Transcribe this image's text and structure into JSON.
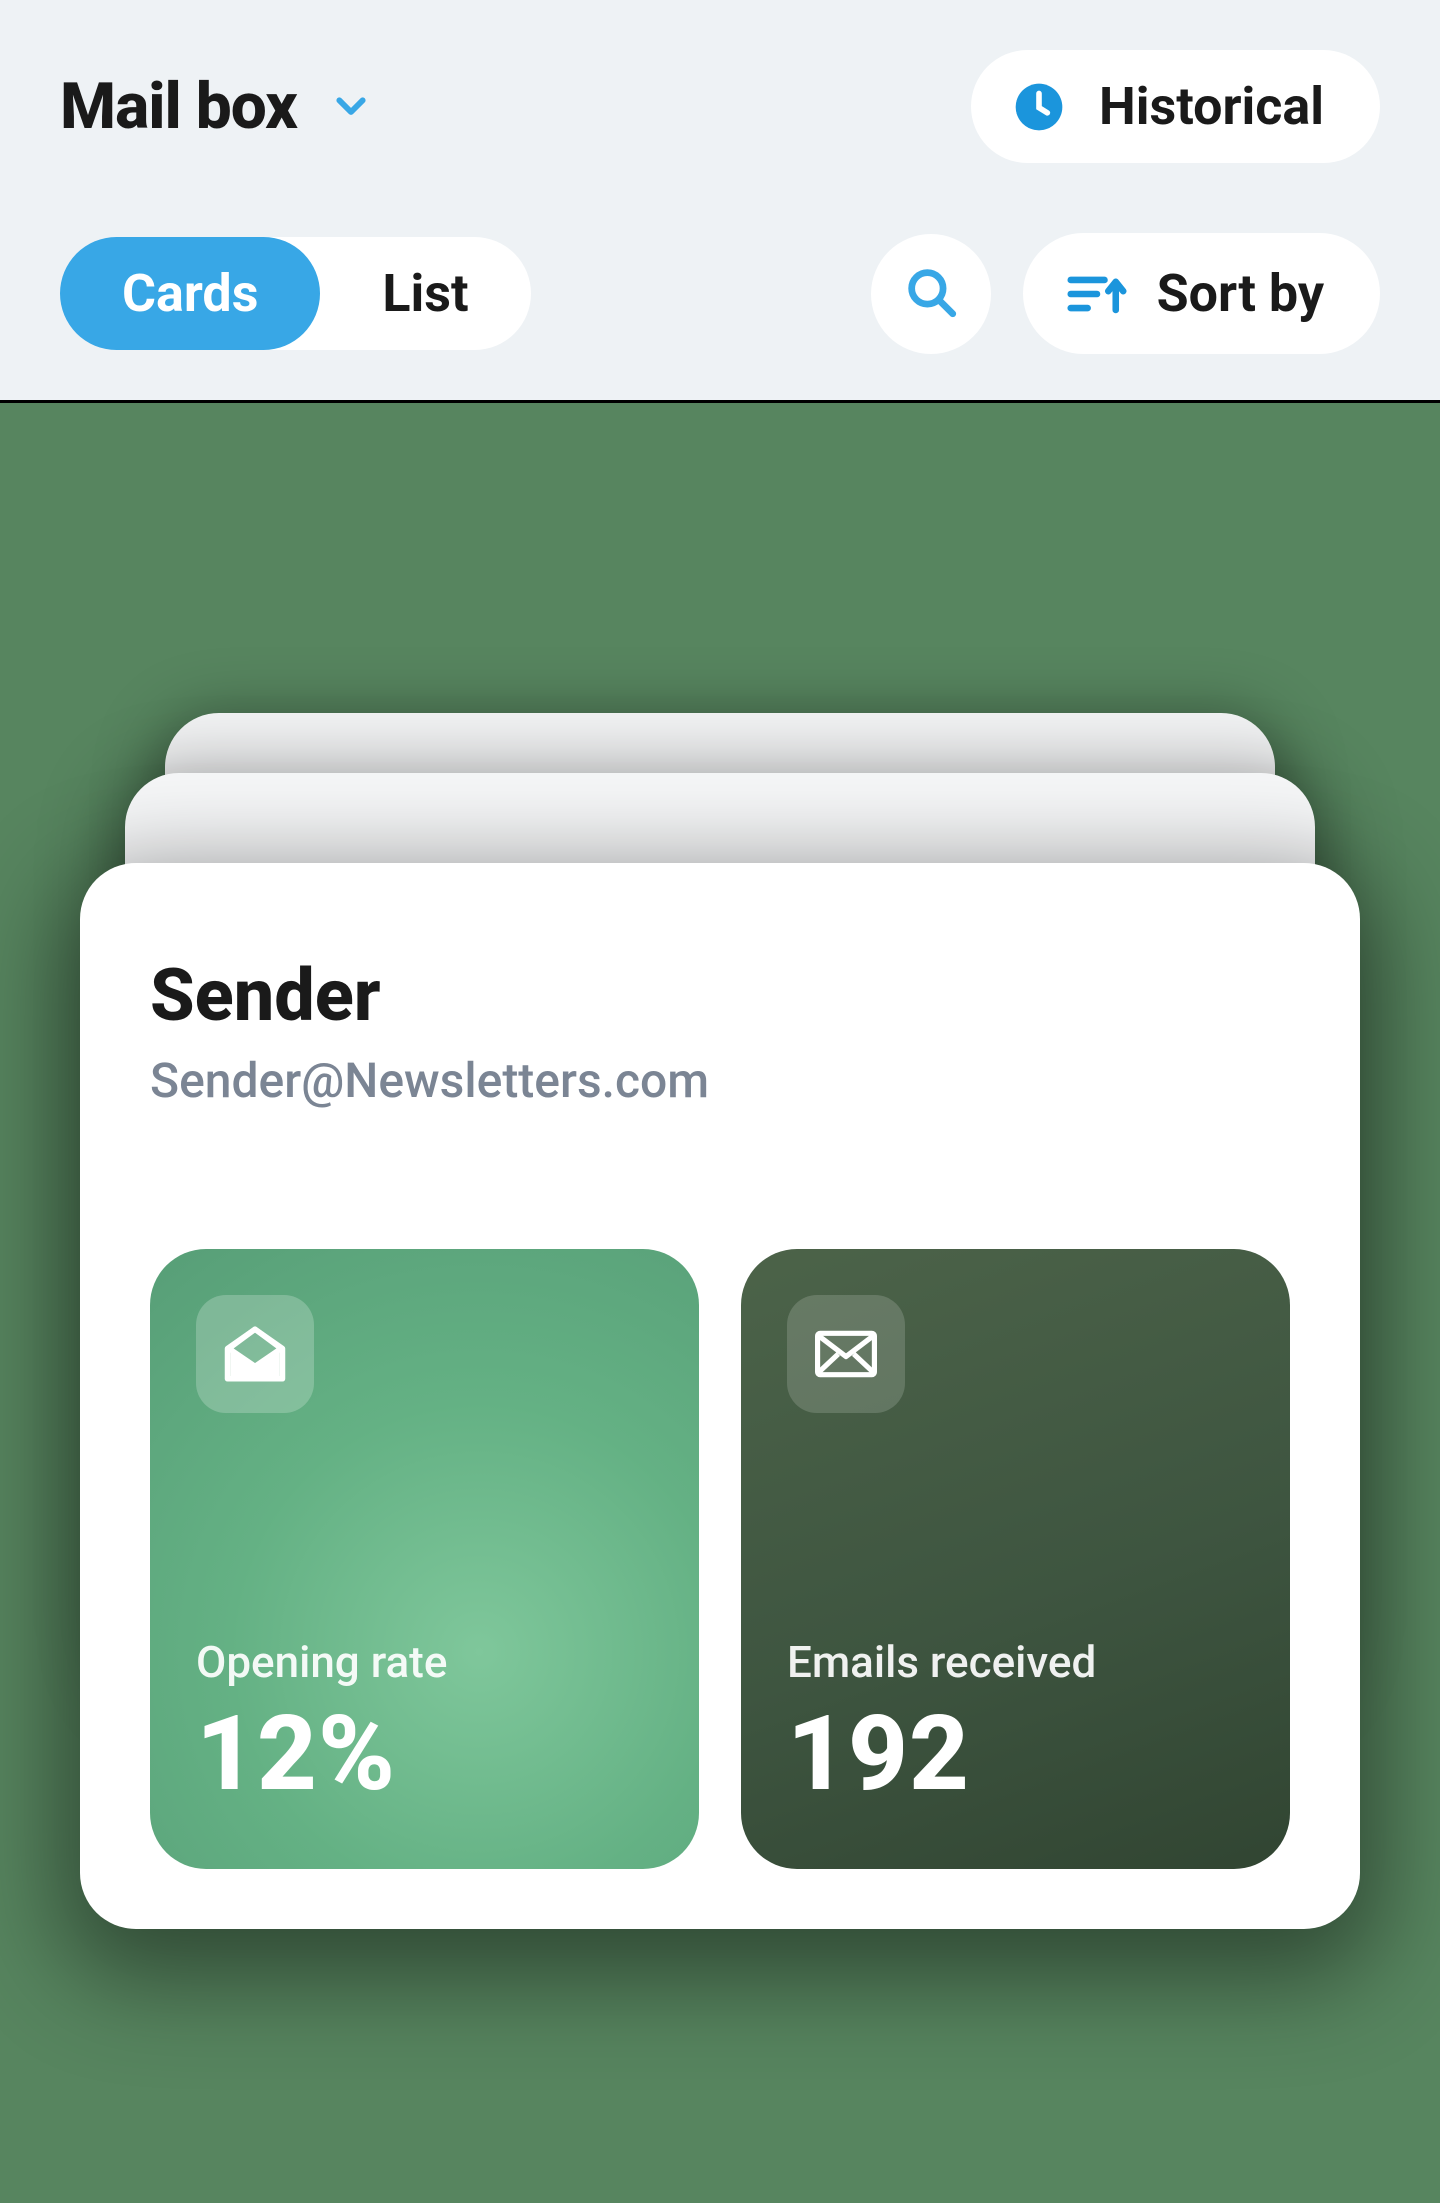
{
  "header": {
    "title": "Mail box",
    "historical_label": "Historical"
  },
  "toolbar": {
    "view_cards_label": "Cards",
    "view_list_label": "List",
    "active_view": "cards",
    "sort_label": "Sort by"
  },
  "card": {
    "sender_heading": "Sender",
    "sender_email": "Sender@Newsletters.com",
    "stats": {
      "opening_rate": {
        "label": "Opening rate",
        "value": "12%"
      },
      "emails_received": {
        "label": "Emails received",
        "value": "192"
      }
    }
  },
  "colors": {
    "accent": "#38a7e6",
    "stage_bg": "#57855f"
  }
}
